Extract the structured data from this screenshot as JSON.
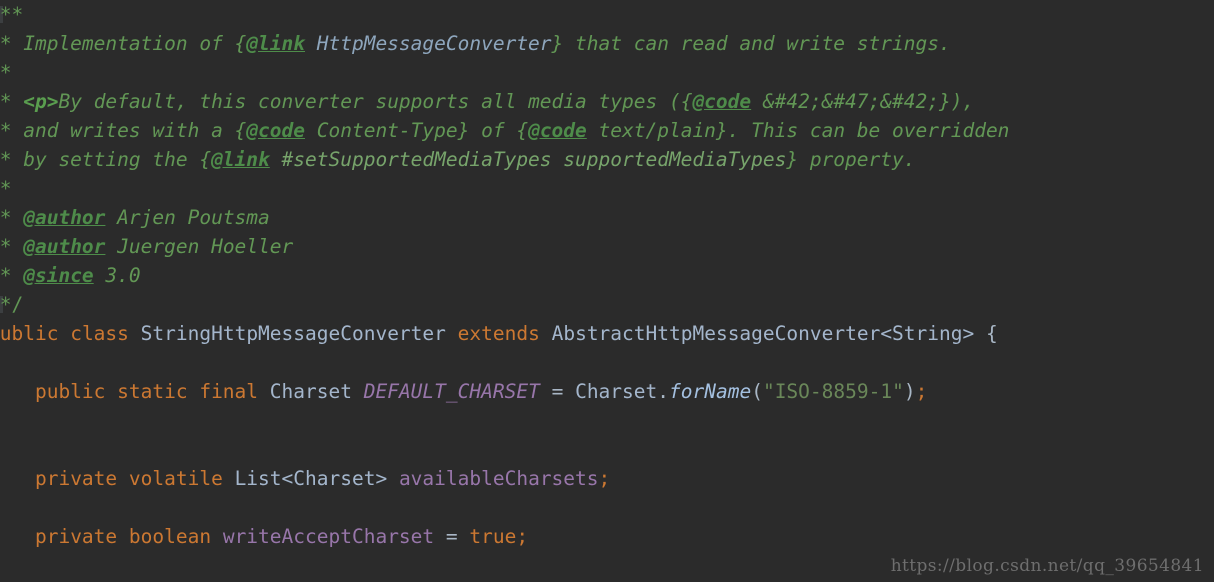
{
  "editor": {
    "background_color": "#2b2b2b",
    "language": "Java",
    "file_kind": "source-code"
  },
  "colors": {
    "background": "#2b2b2b",
    "comment_green": "#629755",
    "javadoc_tag_green": "#4e8c4a",
    "javadoc_link_blue": "#8ea6bd",
    "html_tag_green": "#5a9e4f",
    "keyword_orange": "#cc7832",
    "type_blue": "#a4b6cc",
    "field_purple": "#9876aa",
    "static_method_blue": "#a4c0e0",
    "string_olive": "#6a8759",
    "default_text": "#a9b7c6",
    "watermark_gray": "#6e6e6e"
  },
  "code": {
    "javadoc_open": "/**",
    "javadoc_close": " */",
    "star": " *",
    "line2": {
      "text_before": " Implementation of {",
      "tag": "@link",
      "link_target": " HttpMessageConverter",
      "text_after": "} that can read and write strings."
    },
    "line4": {
      "html_tag": "<p>",
      "text_before": "By default, this converter supports all media types ({",
      "tag": "@code",
      "code_value": " &#42;&#47;&#42;",
      "text_after": "}),"
    },
    "line5": {
      "text_before": " and writes with a {",
      "tag1": "@code",
      "code_value1": " Content-Type",
      "mid": "} of {",
      "tag2": "@code",
      "code_value2": " text/plain",
      "text_after": "}. This can be overridden"
    },
    "line6": {
      "text_before": " by setting the {",
      "tag": "@link",
      "link_target": " #setSupportedMediaTypes supportedMediaTypes",
      "text_after": "} property."
    },
    "authors": [
      {
        "tag": "@author",
        "value": " Arjen Poutsma"
      },
      {
        "tag": "@author",
        "value": " Juergen Hoeller"
      }
    ],
    "since": {
      "tag": "@since",
      "value": " 3.0"
    },
    "class_decl": {
      "modifier": "public",
      "keyword": "class",
      "name": "StringHttpMessageConverter",
      "extends_kw": "extends",
      "super_type": "AbstractHttpMessageConverter<String>",
      "brace": "{"
    },
    "field_default_charset": {
      "modifiers": "public static final",
      "type": "Charset",
      "name": "DEFAULT_CHARSET",
      "assign": "=",
      "owner": "Charset",
      "dot": ".",
      "method": "forName",
      "open_paren": "(",
      "argument": "\"ISO-8859-1\"",
      "close_paren": ")",
      "semicolon": ";"
    },
    "field_available_charsets": {
      "modifiers": "private volatile",
      "type": "List<Charset>",
      "name": "availableCharsets",
      "semicolon": ";"
    },
    "field_write_accept_charset": {
      "modifiers": "private boolean",
      "name": "writeAcceptCharset",
      "assign": "=",
      "value": "true",
      "semicolon": ";"
    }
  },
  "watermark": {
    "text": "https://blog.csdn.net/qq_39654841"
  }
}
